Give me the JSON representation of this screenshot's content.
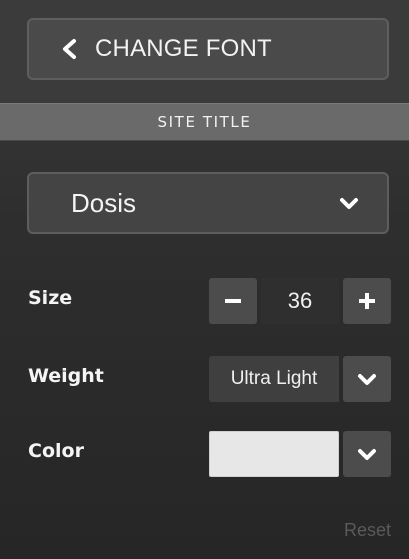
{
  "header": {
    "back_label": "CHANGE FONT"
  },
  "section": {
    "title": "SITE TITLE"
  },
  "font": {
    "selected": "Dosis"
  },
  "size": {
    "label": "Size",
    "value": "36",
    "minus_symbol": "−",
    "plus_symbol": "+"
  },
  "weight": {
    "label": "Weight",
    "selected": "Ultra Light"
  },
  "color": {
    "label": "Color",
    "swatch_hex": "#e7e7e7"
  },
  "footer": {
    "reset_label": "Reset"
  },
  "icons": {
    "back": "chevron-left-icon",
    "dropdown": "chevron-down-icon"
  }
}
